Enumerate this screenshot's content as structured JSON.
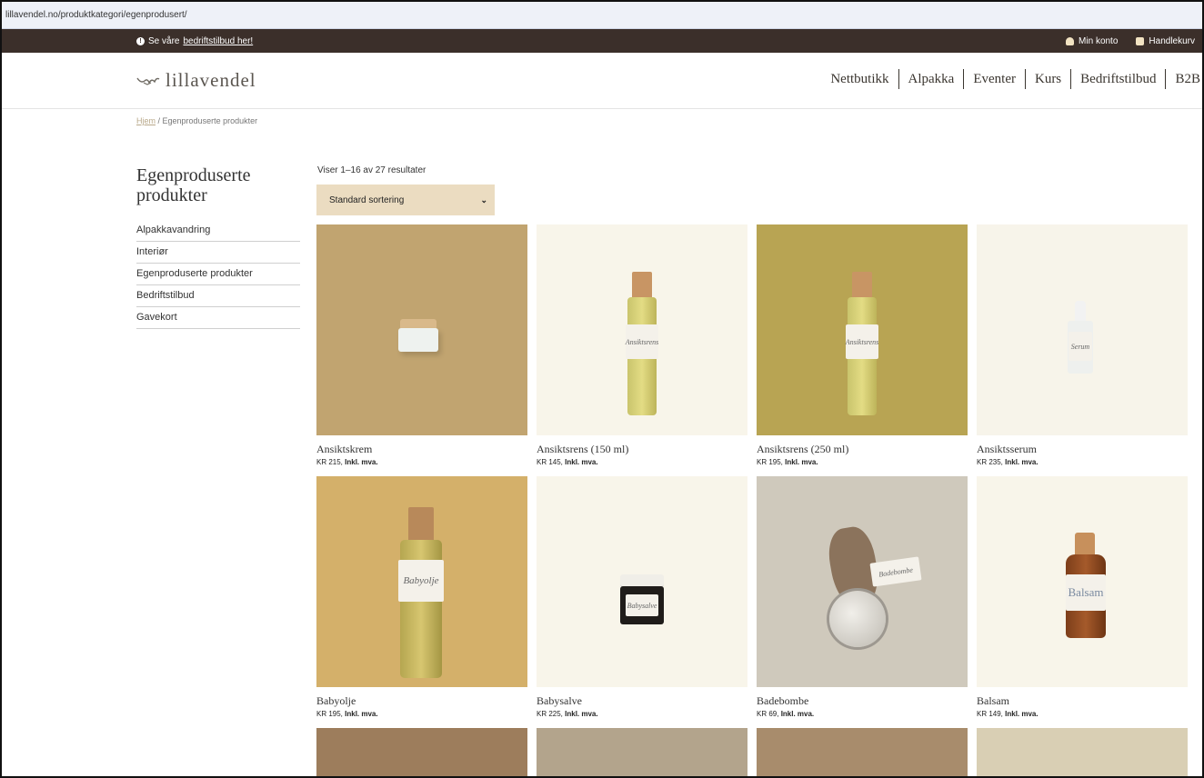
{
  "browser": {
    "url": "lillavendel.no/produktkategori/egenprodusert/"
  },
  "topbar": {
    "promo_prefix": "Se våre ",
    "promo_link": "bedriftstilbud her!",
    "account_label": "Min konto",
    "cart_label": "Handlekurv"
  },
  "header": {
    "logo_text": "lillavendel",
    "nav": [
      "Nettbutikk",
      "Alpakka",
      "Eventer",
      "Kurs",
      "Bedriftstilbud",
      "B2B"
    ]
  },
  "breadcrumb": {
    "home": "Hjem",
    "separator": " / ",
    "current": "Egenproduserte produkter"
  },
  "sidebar": {
    "title": "Egenproduserte produkter",
    "items": [
      "Alpakkavandring",
      "Interiør",
      "Egenproduserte produkter",
      "Bedriftstilbud",
      "Gavekort"
    ]
  },
  "catalog": {
    "results_text": "Viser 1–16 av 27 resultater",
    "sort_selected": "Standard sortering",
    "products": [
      {
        "name": "Ansiktskrem",
        "price": "KR 215,",
        "tax": "Inkl. mva.",
        "bg": "#c1a470",
        "kind": "jar-white"
      },
      {
        "name": "Ansiktsrens (150 ml)",
        "price": "KR 145,",
        "tax": "Inkl. mva.",
        "bg": "#f8f5ea",
        "kind": "bottle-tall",
        "label_text": "Ansiktsrens"
      },
      {
        "name": "Ansiktsrens (250 ml)",
        "price": "KR 195,",
        "tax": "Inkl. mva.",
        "bg": "#b8a453",
        "kind": "bottle-tall",
        "label_text": "Ansiktsrens"
      },
      {
        "name": "Ansiktsserum",
        "price": "KR 235,",
        "tax": "Inkl. mva.",
        "bg": "#f7f4ea",
        "kind": "dropper",
        "label_text": "Serum"
      },
      {
        "name": "Babyolje",
        "price": "KR 195,",
        "tax": "Inkl. mva.",
        "bg": "#d4b06a",
        "kind": "bottle-big",
        "label_text": "Babyolje"
      },
      {
        "name": "Babysalve",
        "price": "KR 225,",
        "tax": "Inkl. mva.",
        "bg": "#f8f5ea",
        "kind": "jar-dark",
        "label_text": "Babysalve"
      },
      {
        "name": "Badebombe",
        "price": "KR 69,",
        "tax": "Inkl. mva.",
        "bg": "#cfc9bc",
        "kind": "bomb",
        "label_text": "Badebombe"
      },
      {
        "name": "Balsam",
        "price": "KR 149,",
        "tax": "Inkl. mva.",
        "bg": "#f8f5ea",
        "kind": "amber",
        "label_text": "Balsam"
      }
    ],
    "partial_row_bgs": [
      "#9d7d5c",
      "#b3a48c",
      "#a88c6c",
      "#d9cfb4"
    ]
  }
}
